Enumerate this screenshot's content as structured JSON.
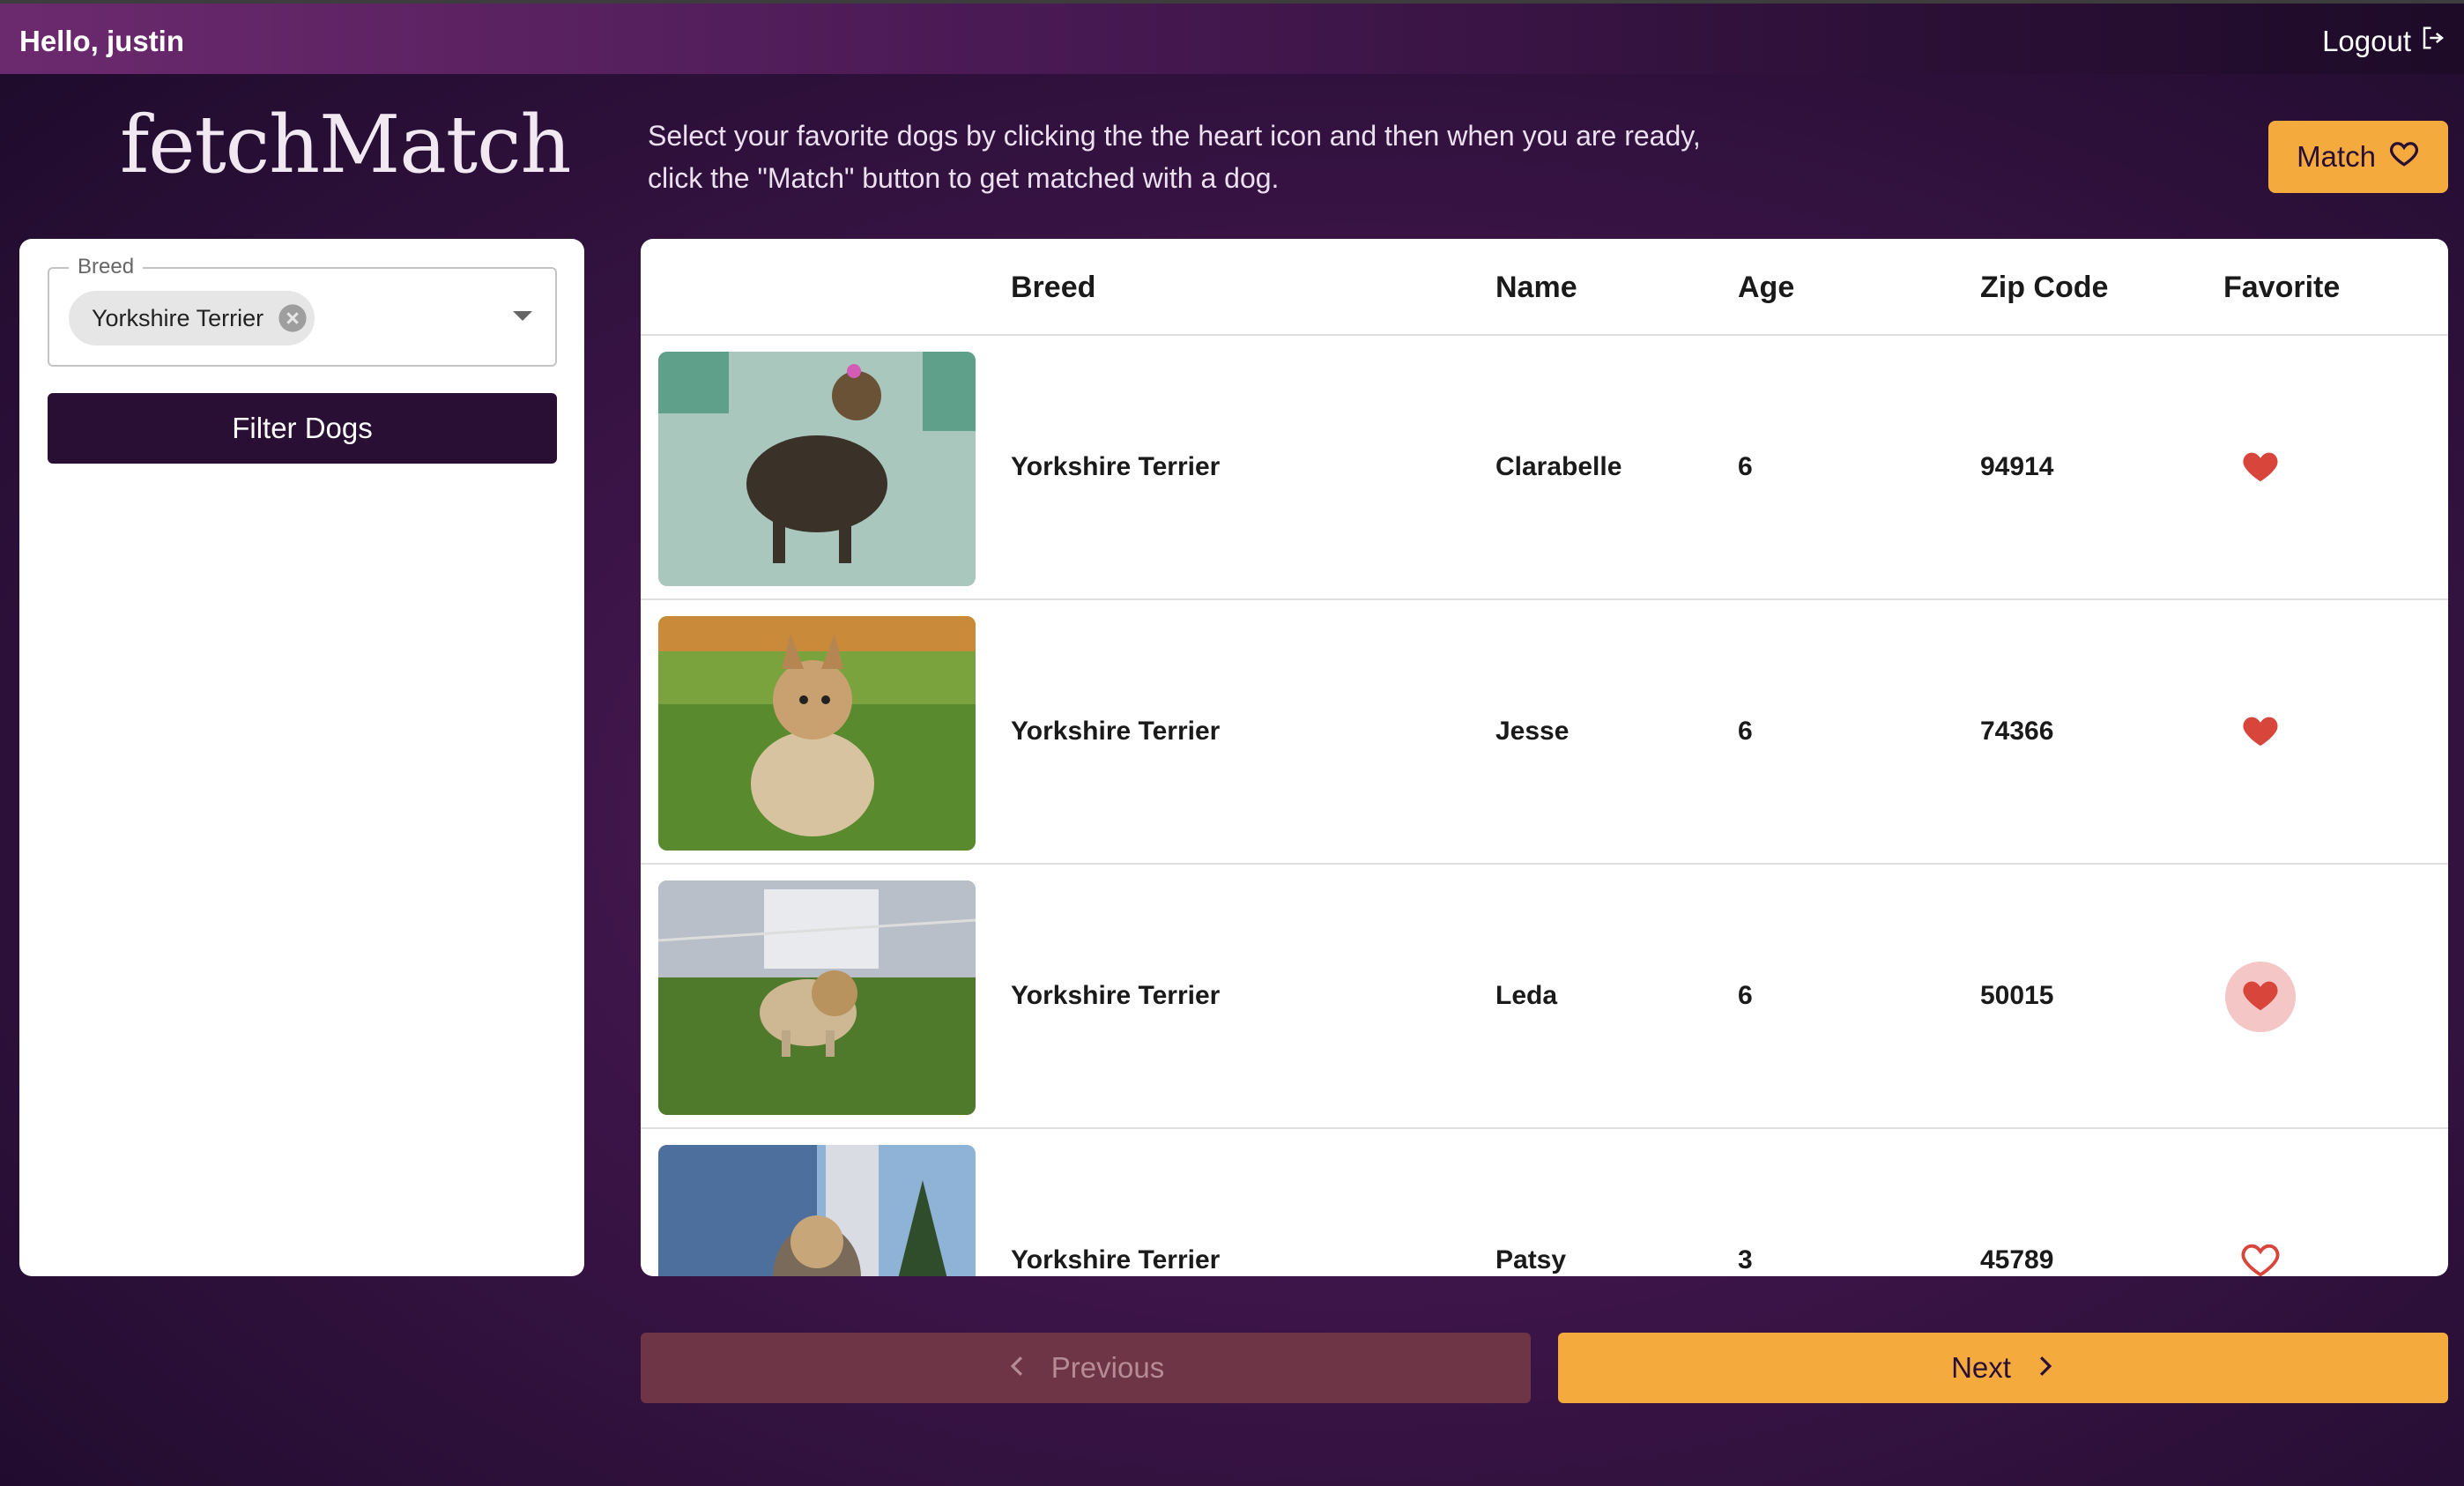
{
  "header": {
    "greeting": "Hello, justin",
    "logout_label": "Logout"
  },
  "brand": {
    "logo": "fetchMatch",
    "instructions": "Select your favorite dogs by clicking the the heart icon and then when you are ready, click the \"Match\" button to get matched with a dog.",
    "match_label": "Match"
  },
  "filters": {
    "breed_label": "Breed",
    "selected_breed": "Yorkshire Terrier",
    "filter_button": "Filter Dogs"
  },
  "table": {
    "columns": [
      "Breed",
      "Name",
      "Age",
      "Zip Code",
      "Favorite"
    ],
    "rows": [
      {
        "breed": "Yorkshire Terrier",
        "name": "Clarabelle",
        "age": "6",
        "zip": "94914",
        "favorite": true
      },
      {
        "breed": "Yorkshire Terrier",
        "name": "Jesse",
        "age": "6",
        "zip": "74366",
        "favorite": true
      },
      {
        "breed": "Yorkshire Terrier",
        "name": "Leda",
        "age": "6",
        "zip": "50015",
        "favorite": true
      },
      {
        "breed": "Yorkshire Terrier",
        "name": "Patsy",
        "age": "3",
        "zip": "45789",
        "favorite": false
      }
    ]
  },
  "pagination": {
    "previous_label": "Previous",
    "next_label": "Next"
  },
  "colors": {
    "accent": "#f5aa3d",
    "primary_dark": "#2a0f35",
    "heart": "#d8453b"
  },
  "icons": [
    "logout-icon",
    "heart-outline-icon",
    "clear-chip-icon",
    "dropdown-arrow-icon",
    "heart-filled-icon",
    "chevron-left-icon",
    "chevron-right-icon"
  ]
}
